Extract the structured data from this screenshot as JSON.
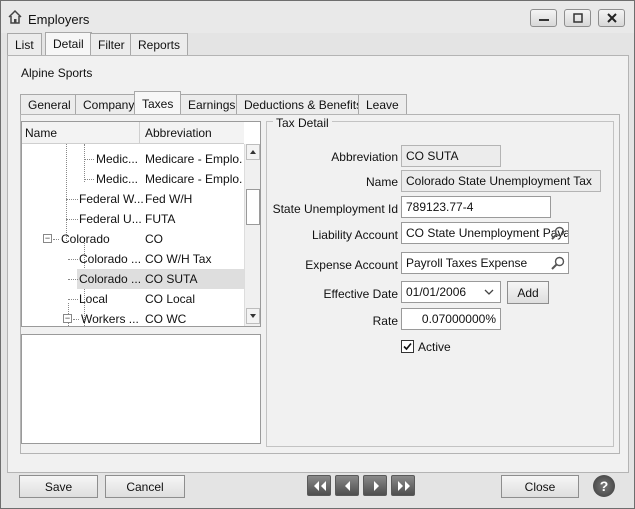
{
  "window": {
    "title": "Employers"
  },
  "top_tabs": [
    {
      "label": "List"
    },
    {
      "label": "Detail"
    },
    {
      "label": "Filter"
    },
    {
      "label": "Reports"
    }
  ],
  "company_name": "Alpine Sports",
  "sub_tabs": [
    {
      "label": "General"
    },
    {
      "label": "Company"
    },
    {
      "label": "Taxes"
    },
    {
      "label": "Earnings"
    },
    {
      "label": "Deductions & Benefits"
    },
    {
      "label": "Leave"
    }
  ],
  "tree": {
    "columns": {
      "name": "Name",
      "abbreviation": "Abbreviation"
    },
    "rows": [
      {
        "name": "Medic...",
        "abbr": "Medicare - Emplo..."
      },
      {
        "name": "Medic...",
        "abbr": "Medicare - Emplo..."
      },
      {
        "name": "Federal W...",
        "abbr": "Fed W/H"
      },
      {
        "name": "Federal U...",
        "abbr": "FUTA"
      },
      {
        "name": "Colorado",
        "abbr": "CO"
      },
      {
        "name": "Colorado ...",
        "abbr": "CO W/H Tax"
      },
      {
        "name": "Colorado ...",
        "abbr": "CO SUTA"
      },
      {
        "name": "Local",
        "abbr": "CO Local"
      },
      {
        "name": "Workers ...",
        "abbr": "CO WC"
      }
    ]
  },
  "tax_detail": {
    "legend": "Tax Detail",
    "abbreviation_label": "Abbreviation",
    "abbreviation": "CO SUTA",
    "name_label": "Name",
    "name": "Colorado State Unemployment Tax",
    "sui_label": "State Unemployment Id",
    "sui": "789123.77-4",
    "liability_label": "Liability Account",
    "liability": "CO State Unemployment Paya",
    "expense_label": "Expense Account",
    "expense": "Payroll Taxes Expense",
    "effective_label": "Effective Date",
    "effective": "01/01/2006",
    "add_label": "Add",
    "rate_label": "Rate",
    "rate": "0.07000000%",
    "active_label": "Active",
    "active": true
  },
  "footer": {
    "save": "Save",
    "cancel": "Cancel",
    "close": "Close",
    "help": "?"
  },
  "colors": {
    "selected_row": "#dedede",
    "nav_button": "#5a5a5a"
  }
}
